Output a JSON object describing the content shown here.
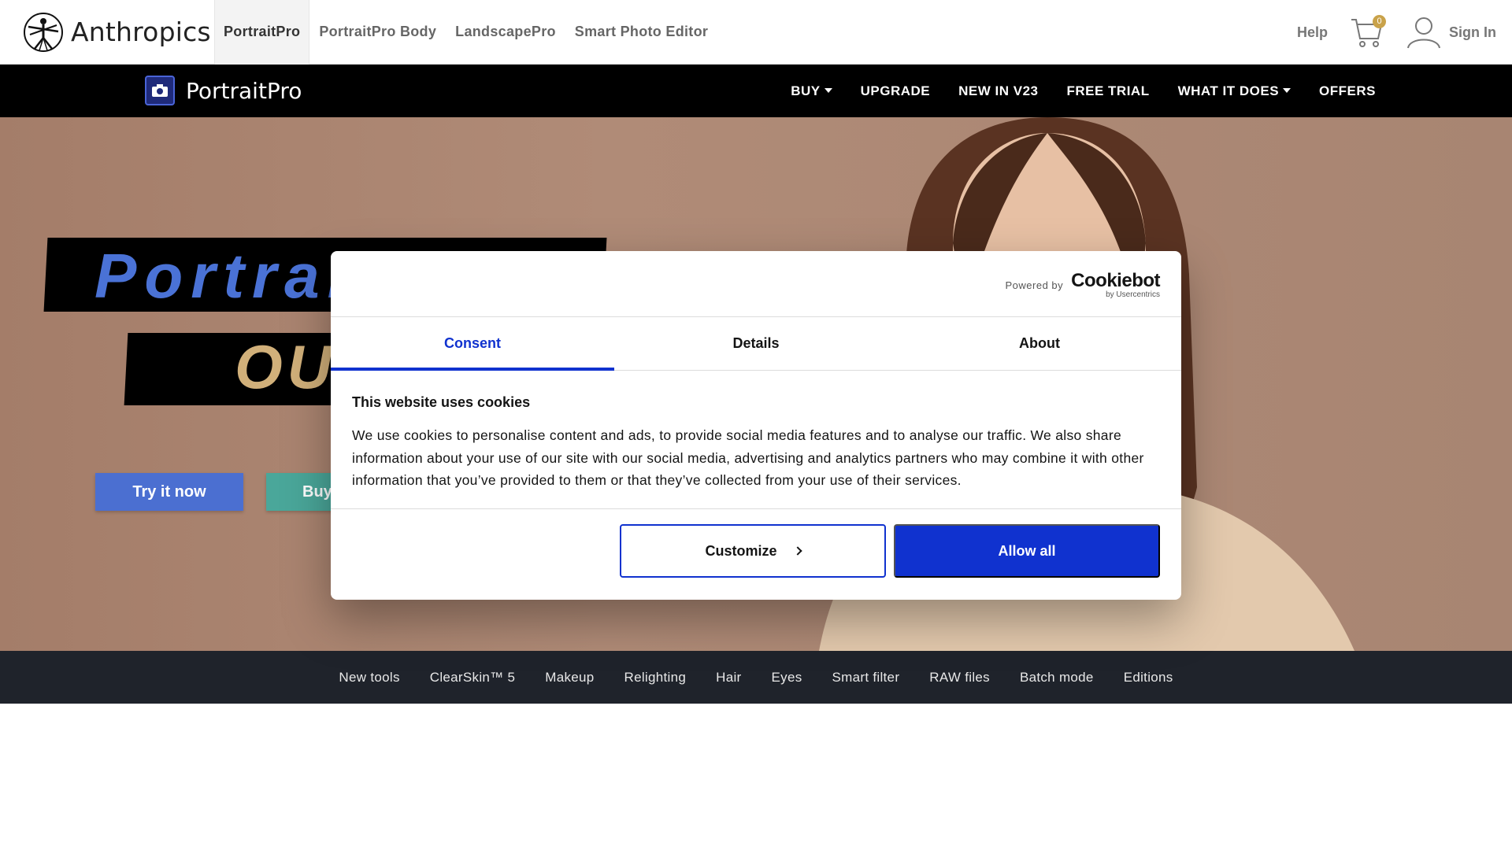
{
  "topbar": {
    "brand": "Anthropics",
    "products": [
      {
        "label": "PortraitPro",
        "active": true
      },
      {
        "label": "PortraitPro Body",
        "active": false
      },
      {
        "label": "LandscapePro",
        "active": false
      },
      {
        "label": "Smart Photo Editor",
        "active": false
      }
    ],
    "help": "Help",
    "cart_count": "0",
    "sign_in": "Sign In",
    "icons": [
      "vitruvian-logo-icon",
      "cart-icon",
      "user-icon"
    ]
  },
  "mainnav": {
    "logo_text": "PortraitPro",
    "items": [
      {
        "label": "BUY",
        "dropdown": true
      },
      {
        "label": "UPGRADE",
        "dropdown": false
      },
      {
        "label": "NEW IN V23",
        "dropdown": false
      },
      {
        "label": "FREE TRIAL",
        "dropdown": false
      },
      {
        "label": "WHAT IT DOES",
        "dropdown": true
      },
      {
        "label": "OFFERS",
        "dropdown": false
      }
    ]
  },
  "hero": {
    "line1": "Portrait",
    "line2": "OU",
    "try_label": "Try it now",
    "buy_label": "Buy",
    "colors": {
      "try": "#4b6fd1",
      "buy": "#4aa79a",
      "line1": "#4a72d6",
      "line2": "#d1b07a"
    }
  },
  "featurenav": {
    "items": [
      "New tools",
      "ClearSkin™ 5",
      "Makeup",
      "Relighting",
      "Hair",
      "Eyes",
      "Smart filter",
      "RAW files",
      "Batch mode",
      "Editions"
    ]
  },
  "cookie": {
    "powered_by": "Powered by",
    "brand": "Cookiebot",
    "brand_sub": "by Usercentrics",
    "tabs": [
      {
        "label": "Consent",
        "active": true
      },
      {
        "label": "Details",
        "active": false
      },
      {
        "label": "About",
        "active": false
      }
    ],
    "title": "This website uses cookies",
    "text": "We use cookies to personalise content and ads, to provide social media features and to analyse our traffic. We also share information about your use of our site with our social media, advertising and analytics partners who may combine it with other information that you’ve provided to them or that they’ve collected from your use of their services.",
    "customize_label": "Customize",
    "allow_label": "Allow all",
    "accent": "#1032cf"
  }
}
